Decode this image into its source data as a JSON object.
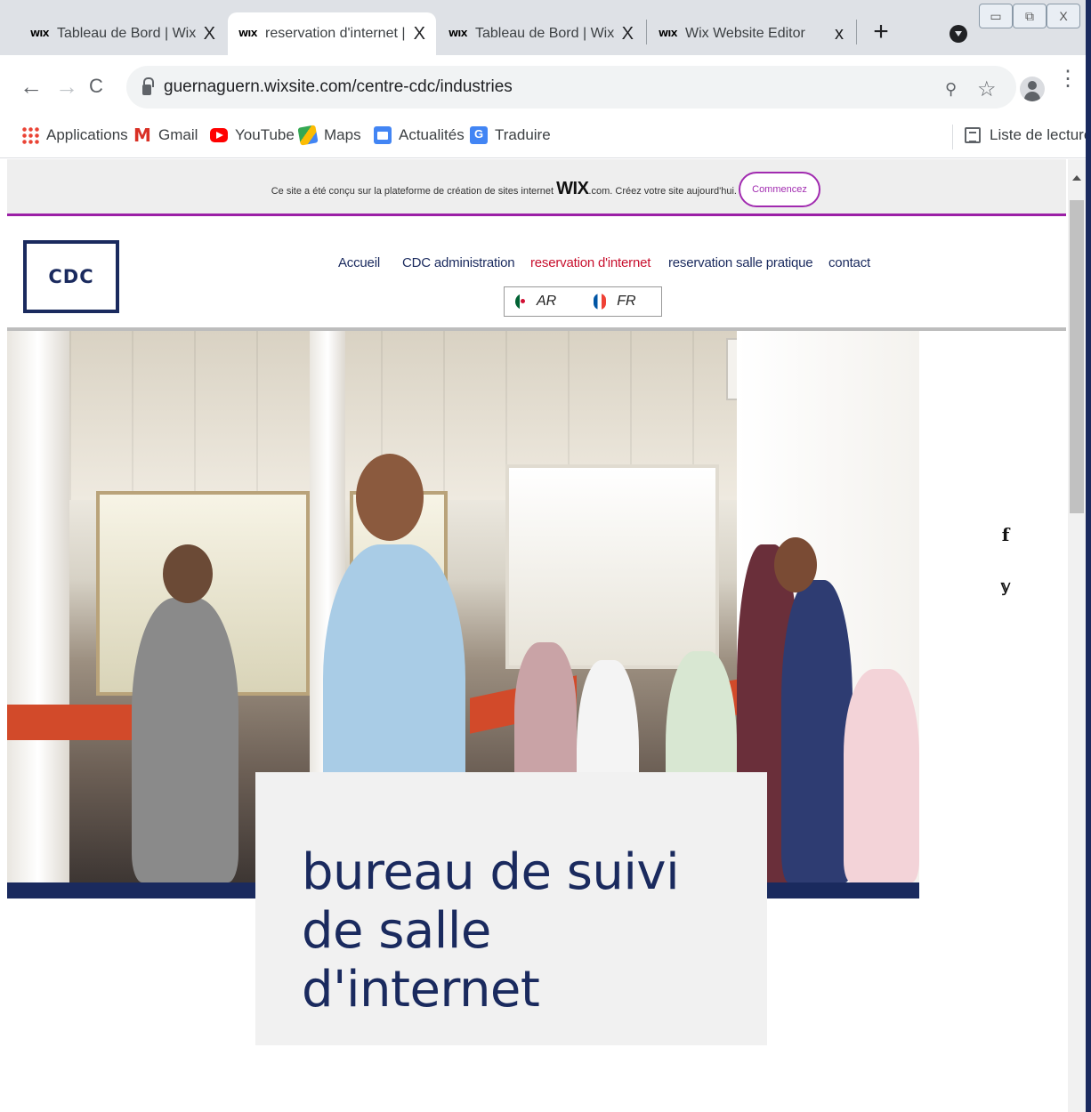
{
  "browser": {
    "tabs": [
      {
        "favicon": "WIX",
        "title": "Tableau de Bord | Wix.co",
        "close": "X",
        "active": false
      },
      {
        "favicon": "WIX",
        "title": "reservation d'internet | M",
        "close": "X",
        "active": true
      },
      {
        "favicon": "WIX",
        "title": "Tableau de Bord | Wix.co",
        "close": "X",
        "active": false
      },
      {
        "favicon": "WIX",
        "title": "Wix Website Editor",
        "close": "x",
        "active": false
      }
    ],
    "new_tab": "+",
    "address": {
      "url": "guernaguern.wixsite.com/centre-cdc/industries"
    },
    "nav": {
      "back": "←",
      "forward": "→",
      "reload": "C"
    },
    "toolbar_icons": {
      "zoom": "⚲",
      "star": "☆",
      "menu": "⋮"
    },
    "bookmarks": [
      {
        "label": "Applications",
        "icon": "apps-grid-icon"
      },
      {
        "label": "Gmail",
        "icon": "gmail-icon"
      },
      {
        "label": "YouTube",
        "icon": "youtube-icon"
      },
      {
        "label": "Maps",
        "icon": "maps-icon"
      },
      {
        "label": "Actualités",
        "icon": "news-icon"
      },
      {
        "label": "Traduire",
        "icon": "translate-icon"
      }
    ],
    "reading_list": "Liste de lecture",
    "window_controls": {
      "minimize": "▭",
      "restore": "⧉",
      "close": "X"
    }
  },
  "wix_banner": {
    "text_before": "Ce site a été conçu sur la plateforme de création de sites internet ",
    "wix_logo": "WIX",
    "text_after": ".com. Créez votre site aujourd'hui.",
    "button": "Commencez",
    "accent": "#a12bb0"
  },
  "site": {
    "logo": "CDC",
    "nav": [
      {
        "label": "Accueil",
        "active": false
      },
      {
        "label": "CDC administration",
        "active": false
      },
      {
        "label": "reservation d'internet",
        "active": true
      },
      {
        "label": "reservation salle pratique",
        "active": false
      },
      {
        "label": "contact",
        "active": false
      }
    ],
    "languages": [
      {
        "code": "AR",
        "flag": "algeria-flag-icon"
      },
      {
        "code": "FR",
        "flag": "france-flag-icon"
      }
    ],
    "social": [
      {
        "glyph": "f",
        "icon": "facebook-icon"
      },
      {
        "glyph": "𝕪",
        "icon": "twitter-icon"
      }
    ],
    "caption": "bureau de suivi de salle d'internet",
    "colors": {
      "navy": "#1a2a5e",
      "active_nav": "#c8102e"
    }
  }
}
